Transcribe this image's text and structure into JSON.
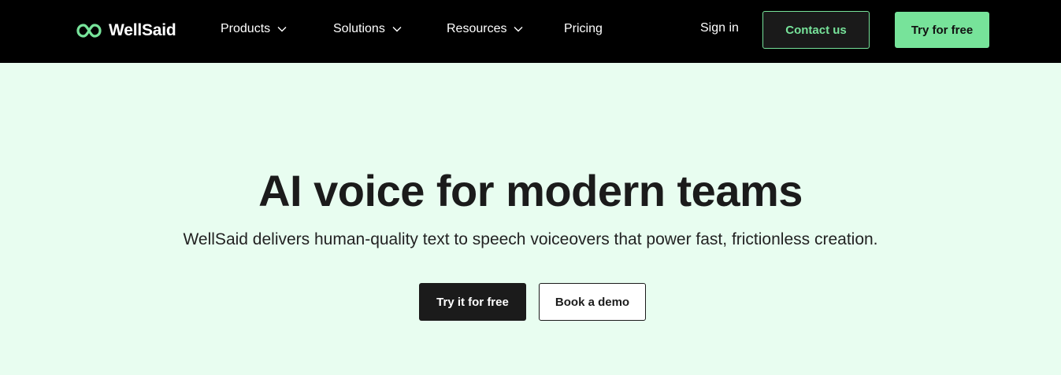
{
  "brand": {
    "name": "WellSaid",
    "accent": "#77e39a",
    "logo_icon": "infinity-heart-icon"
  },
  "nav": {
    "items": [
      {
        "label": "Products",
        "dropdown": true
      },
      {
        "label": "Solutions",
        "dropdown": true
      },
      {
        "label": "Resources",
        "dropdown": true
      },
      {
        "label": "Pricing",
        "dropdown": false
      }
    ],
    "sign_in": "Sign in",
    "contact": "Contact us",
    "try_free": "Try for free"
  },
  "hero": {
    "title": "AI voice for modern teams",
    "subtitle": "WellSaid delivers human-quality text to speech voiceovers that power fast, frictionless creation.",
    "primary_cta": "Try it for free",
    "secondary_cta": "Book a demo"
  },
  "colors": {
    "topbar": "#000000",
    "hero_bg": "#e8fdf0",
    "dark": "#1b1b1b"
  }
}
